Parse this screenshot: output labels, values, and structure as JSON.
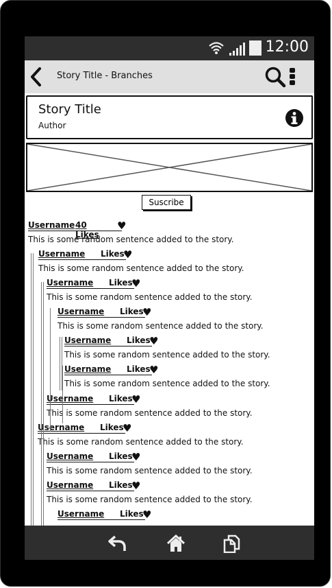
{
  "status": {
    "time": "12:00",
    "wifi_icon": "wifi-icon",
    "signal_icon": "signal-icon",
    "battery_icon": "battery-icon"
  },
  "appbar": {
    "title": "Story Title - Branches"
  },
  "story": {
    "title": "Story Title",
    "author": "Author"
  },
  "subscribe_label": "Suscribe",
  "comments": [
    {
      "user": "Username",
      "likes": "40 Likes",
      "text": "This is some random sentence added to the story."
    },
    {
      "user": "Username",
      "likes": "Likes",
      "text": "This is some random sentence added to the story."
    },
    {
      "user": "Username",
      "likes": "Likes",
      "text": "This is some random sentence added to the story."
    },
    {
      "user": "Username",
      "likes": "Likes",
      "text": "This is some random sentence added to the story."
    },
    {
      "user": "Username",
      "likes": "Likes",
      "text": "This is some random sentence added to the story."
    },
    {
      "user": "Username",
      "likes": "Likes",
      "text": "This is some random sentence added to the story."
    },
    {
      "user": "Username",
      "likes": "Likes",
      "text": "This is some random sentence added to the story."
    },
    {
      "user": "Username",
      "likes": "Likes",
      "text": "This is some random sentence added to the story."
    },
    {
      "user": "Username",
      "likes": "Likes",
      "text": "This is some random sentence added to the story."
    },
    {
      "user": "Username",
      "likes": "Likes",
      "text": "This is some random sentence added to the story."
    },
    {
      "user": "Username",
      "likes": "Likes",
      "text": ""
    }
  ]
}
